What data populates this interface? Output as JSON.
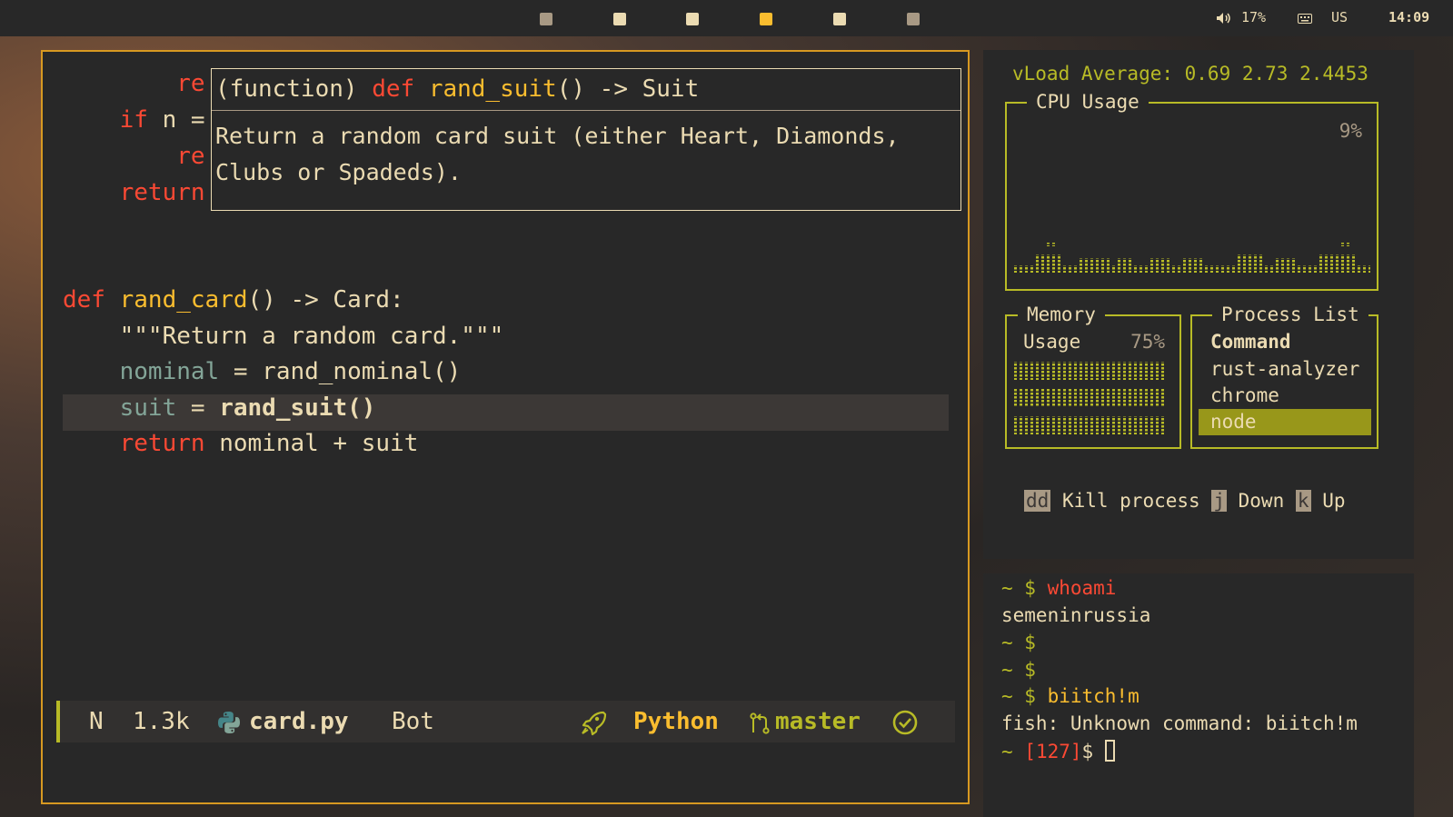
{
  "topbar": {
    "workspaces": [
      {
        "color": "#a89984"
      },
      {
        "color": "#ebdbb2"
      },
      {
        "color": "#ebdbb2"
      },
      {
        "color": "#fabd2f"
      },
      {
        "color": "#ebdbb2"
      },
      {
        "color": "#a89984"
      }
    ],
    "volume_icon": "speaker-icon",
    "volume": "17%",
    "keyboard_icon": "keyboard-icon",
    "layout": "US",
    "clock": "14:09"
  },
  "editor": {
    "hidden_lines": {
      "l1": "re",
      "l2_kw": "if",
      "l2_rest": " n =",
      "l3": "re",
      "l4": "return"
    },
    "hover": {
      "prefix": "(function) ",
      "kw": "def",
      "name": "rand_suit",
      "suffix": "() -> Suit",
      "doc": "Return a random card suit (either Heart, Diamonds, Clubs or Spadeds)."
    },
    "code": {
      "def_kw": "def",
      "def_name": "rand_card",
      "def_rest": "() -> Card:",
      "docstring": "\"\"\"Return a random card.\"\"\"",
      "l3_id": "nominal",
      "l3_rest": " = rand_nominal()",
      "l4_id": "suit",
      "l4_eq": " = ",
      "l4_call": "rand_suit()",
      "l5_kw": "return",
      "l5_rest": " nominal + suit"
    },
    "statusline": {
      "mode": "N",
      "size": "1.3k",
      "file_icon": "python-icon",
      "file": "card.py",
      "position": "Bot",
      "lsp_icon": "rocket-icon",
      "language": "Python",
      "git_icon": "git-branch-icon",
      "branch": "master",
      "check_icon": "check-circle-icon"
    }
  },
  "sysmon": {
    "load": "vLoad Average: 0.69 2.73 2.4453",
    "cpu_title": "CPU Usage",
    "cpu_value": "9%",
    "mem_title": "Memory",
    "mem_label": "Usage",
    "mem_value": "75%",
    "proc_title": "Process List",
    "proc_header": "Command",
    "processes": [
      "rust-analyzer",
      "chrome",
      "node"
    ],
    "keys": [
      {
        "key": "dd",
        "action": "Kill process"
      },
      {
        "key": "j",
        "action": "Down"
      },
      {
        "key": "k",
        "action": "Up"
      }
    ],
    "accent": "#b8bb26"
  },
  "terminal": {
    "prompt": "~ $ ",
    "l1_cmd": "whoami",
    "l2": "semeninrussia",
    "l3": "~ $",
    "l4": "~ $",
    "l5_cmd": "biitch!m",
    "l6": "fish: Unknown command: biitch!m",
    "l7_tilde": "~ ",
    "l7_code": "[127]",
    "l7_dollar": "$ "
  }
}
